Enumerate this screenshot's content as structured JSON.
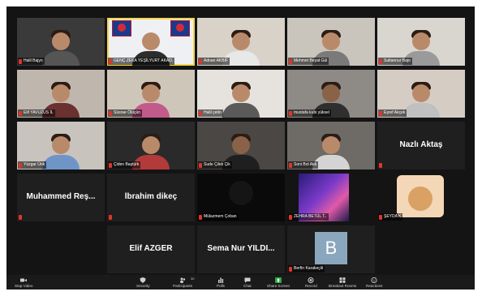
{
  "participants": [
    {
      "name": "Halil Bajyo",
      "type": "video"
    },
    {
      "name": "GENÇ ZEKA YEŞİLYURT AKAD.",
      "type": "video",
      "active": true
    },
    {
      "name": "Adnan AKBİF",
      "type": "video"
    },
    {
      "name": "Mehmet Beyat Gül",
      "type": "video"
    },
    {
      "name": "Sultannur Bajo",
      "type": "video"
    },
    {
      "name": "Elif YAVUZUS İL",
      "type": "video"
    },
    {
      "name": "Süsrae Ölüçün",
      "type": "video"
    },
    {
      "name": "Halil çetin",
      "type": "video"
    },
    {
      "name": "mustafa kubi yüksel",
      "type": "video"
    },
    {
      "name": "Eşref Akçek",
      "type": "video"
    },
    {
      "name": "Yüzgar Ünk",
      "type": "video"
    },
    {
      "name": "Çiden Baştürk",
      "type": "video"
    },
    {
      "name": "Sude Çilek Çik",
      "type": "video"
    },
    {
      "name": "Soni Bol Akk",
      "type": "video"
    },
    {
      "name": "Nazlı Aktaş",
      "type": "name"
    },
    {
      "name": "Muhammed Reş...",
      "type": "name"
    },
    {
      "name": "İbrahim dikeç",
      "type": "name"
    },
    {
      "name": "Mülazmem Çoban",
      "type": "video"
    },
    {
      "name": "ZEHRA BETÜL T..",
      "type": "video"
    },
    {
      "name": "ŞEYDA K",
      "type": "video"
    },
    {
      "name": "Elif AZGER",
      "type": "name"
    },
    {
      "name": "Sema Nur YILDI...",
      "type": "name"
    },
    {
      "name": "Berfin Karakeçili",
      "type": "avatar",
      "initial": "B"
    }
  ],
  "toolbar": {
    "stop_video": "Stop Video",
    "security": "Security",
    "participants": "Participants",
    "participants_count": "30",
    "polls": "Polls",
    "chat": "Chat",
    "share_screen": "Share Screen",
    "record": "Record",
    "breakout_rooms": "Breakout Rooms",
    "reactions": "Reactions"
  },
  "colors": {
    "active_speaker": "#f5d547",
    "mute": "#e0342c",
    "share_green": "#2aa84a"
  }
}
